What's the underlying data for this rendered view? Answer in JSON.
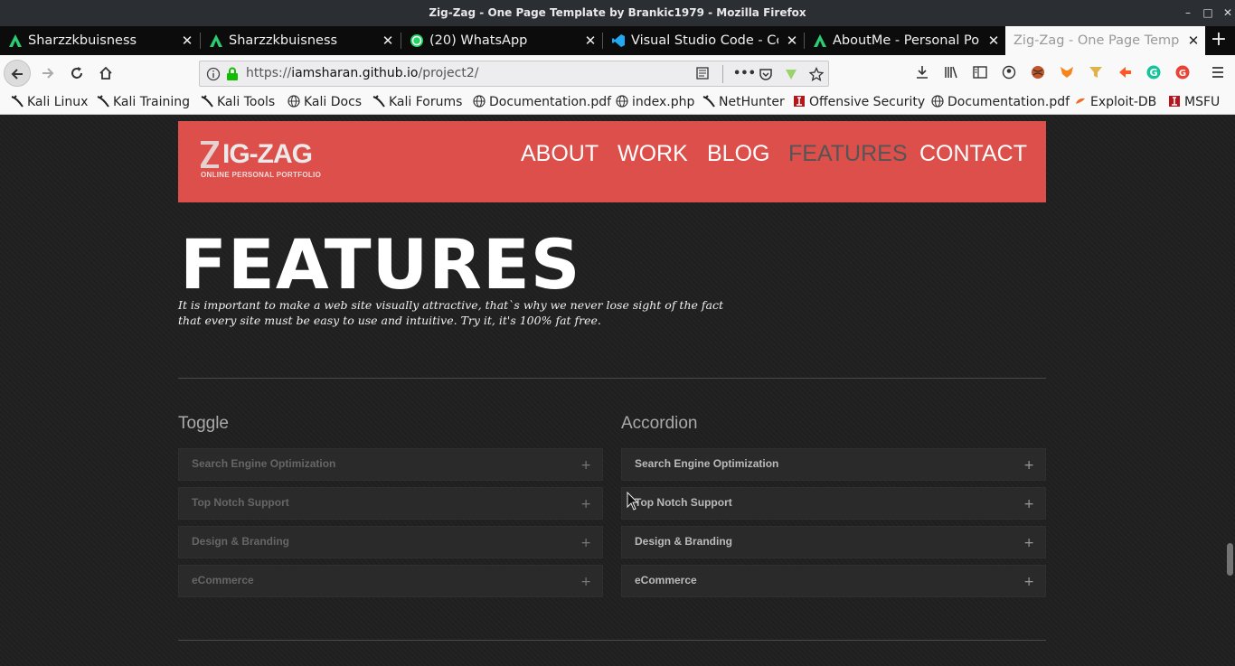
{
  "window": {
    "title": "Zig-Zag - One Page Template by Brankic1979 - Mozilla Firefox",
    "minimize_label": "–",
    "maximize_label": "□",
    "close_label": "✕"
  },
  "tabs": [
    {
      "label": "Sharzzkbuisness",
      "icon": "android-green-a-icon"
    },
    {
      "label": "Sharzzkbuisness",
      "icon": "android-green-a-icon"
    },
    {
      "label": "(20) WhatsApp",
      "icon": "whatsapp-icon"
    },
    {
      "label": "Visual Studio Code - Cod",
      "icon": "vscode-icon"
    },
    {
      "label": "AboutMe - Personal Port",
      "icon": "android-green-a-icon"
    },
    {
      "label": "Zig-Zag - One Page Templa",
      "icon": "none",
      "active": true
    }
  ],
  "tab_close_glyph": "✕",
  "new_tab_glyph": "+",
  "url": {
    "scheme": "https://",
    "host": "iamsharan.github.io",
    "path": "/project2/"
  },
  "bookmarks": [
    {
      "label": "Kali Linux",
      "icon": "kali-dragon-icon"
    },
    {
      "label": "Kali Training",
      "icon": "kali-dragon-icon"
    },
    {
      "label": "Kali Tools",
      "icon": "kali-dragon-icon"
    },
    {
      "label": "Kali Docs",
      "icon": "globe-icon"
    },
    {
      "label": "Kali Forums",
      "icon": "kali-dragon-icon"
    },
    {
      "label": "Documentation.pdf",
      "icon": "globe-icon"
    },
    {
      "label": "index.php",
      "icon": "globe-icon"
    },
    {
      "label": "NetHunter",
      "icon": "kali-dragon-icon"
    },
    {
      "label": "Offensive Security",
      "icon": "offsec-icon"
    },
    {
      "label": "Documentation.pdf",
      "icon": "globe-icon"
    },
    {
      "label": "Exploit-DB",
      "icon": "exploit-db-icon"
    },
    {
      "label": "MSFU",
      "icon": "offsec-icon"
    }
  ],
  "site": {
    "logo_word": "IG-ZAG",
    "logo_tagline": "ONLINE PERSONAL PORTFOLIO",
    "nav": [
      "ABOUT",
      "WORK",
      "BLOG",
      "FEATURES",
      "CONTACT"
    ],
    "current_nav": "FEATURES",
    "features_title": "FEATURES",
    "features_desc": "It is important to make a web site visually attractive, that`s why we never lose sight of the fact that every site must be easy to use and intuitive. Try it, it's 100% fat free.",
    "toggle_heading": "Toggle",
    "accordion_heading": "Accordion",
    "toggle_items": [
      "Search Engine Optimization",
      "Top Notch Support",
      "Design & Branding",
      "eCommerce"
    ],
    "accordion_items": [
      "Search Engine Optimization",
      "Top Notch Support",
      "Design & Branding",
      "eCommerce"
    ],
    "expand_glyph": "+"
  },
  "colors": {
    "header_red": "#dd4f4a",
    "page_bg": "#222222",
    "active_tab_bg": "#f9f9fa"
  }
}
